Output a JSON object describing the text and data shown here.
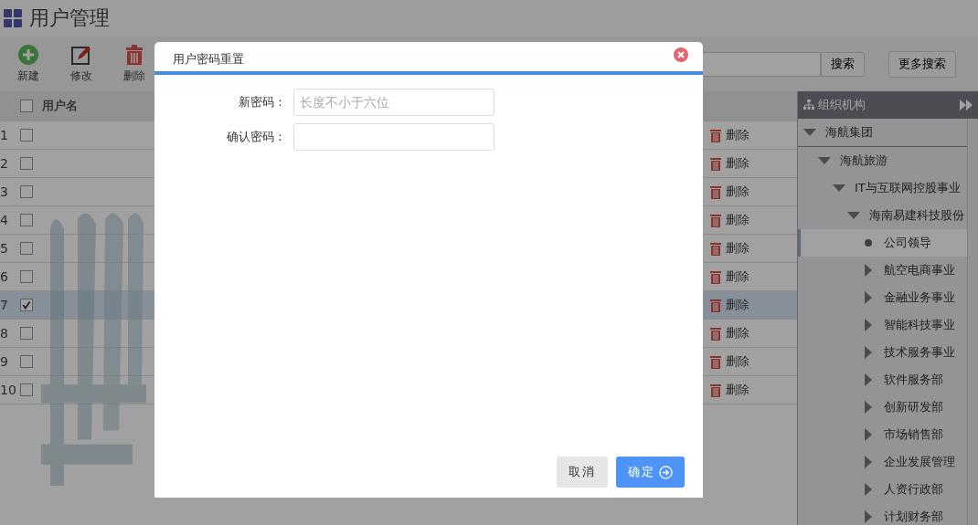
{
  "page": {
    "title": "用户管理"
  },
  "toolbar": [
    {
      "label": "新建",
      "kind": "add"
    },
    {
      "label": "修改",
      "kind": "edit"
    },
    {
      "label": "删除",
      "kind": "delete"
    }
  ],
  "search": {
    "button": "搜索",
    "more_button": "更多搜索"
  },
  "table": {
    "header_checked": false,
    "columns": [
      "用户名"
    ],
    "rows": [
      {
        "number": "1",
        "checked": false,
        "action": "删除"
      },
      {
        "number": "2",
        "checked": false,
        "action": "删除"
      },
      {
        "number": "3",
        "checked": false,
        "action": "删除"
      },
      {
        "number": "4",
        "checked": false,
        "action": "删除"
      },
      {
        "number": "5",
        "checked": false,
        "action": "删除"
      },
      {
        "number": "6",
        "checked": false,
        "action": "删除"
      },
      {
        "number": "7",
        "checked": true,
        "action": "删除"
      },
      {
        "number": "8",
        "checked": false,
        "action": "删除"
      },
      {
        "number": "9",
        "checked": false,
        "action": "删除"
      },
      {
        "number": "10",
        "checked": false,
        "action": "删除"
      }
    ]
  },
  "org_panel": {
    "title": "组织机构",
    "tree": [
      {
        "label": "海航集团",
        "expanded": true,
        "selected": false,
        "children": [
          {
            "label": "海航旅游",
            "expanded": true,
            "selected": false,
            "children": [
              {
                "label": "IT与互联网控股事业",
                "expanded": true,
                "selected": false,
                "children": [
                  {
                    "label": "海南易建科技股份",
                    "expanded": true,
                    "selected": false,
                    "children": [
                      {
                        "label": "公司领导",
                        "kind": "leaf",
                        "selected": true
                      },
                      {
                        "label": "航空电商事业",
                        "expanded": false,
                        "selected": false
                      },
                      {
                        "label": "金融业务事业",
                        "expanded": false,
                        "selected": false
                      },
                      {
                        "label": "智能科技事业",
                        "expanded": false,
                        "selected": false
                      },
                      {
                        "label": "技术服务事业",
                        "expanded": false,
                        "selected": false
                      },
                      {
                        "label": "软件服务部",
                        "expanded": false,
                        "selected": false
                      },
                      {
                        "label": "创新研发部",
                        "expanded": false,
                        "selected": false
                      },
                      {
                        "label": "市场销售部",
                        "expanded": false,
                        "selected": false
                      },
                      {
                        "label": "企业发展管理",
                        "expanded": false,
                        "selected": false
                      },
                      {
                        "label": "人资行政部",
                        "expanded": false,
                        "selected": false
                      },
                      {
                        "label": "计划财务部",
                        "expanded": false,
                        "selected": false
                      }
                    ]
                  }
                ]
              }
            ]
          }
        ]
      }
    ]
  },
  "dialog": {
    "title": "用户密码重置",
    "fields": [
      {
        "label": "新密码：",
        "placeholder": "长度不小于六位"
      },
      {
        "label": "确认密码："
      }
    ],
    "buttons": [
      {
        "label": "取消",
        "kind": "secondary"
      },
      {
        "label": "确定",
        "kind": "primary"
      }
    ]
  }
}
